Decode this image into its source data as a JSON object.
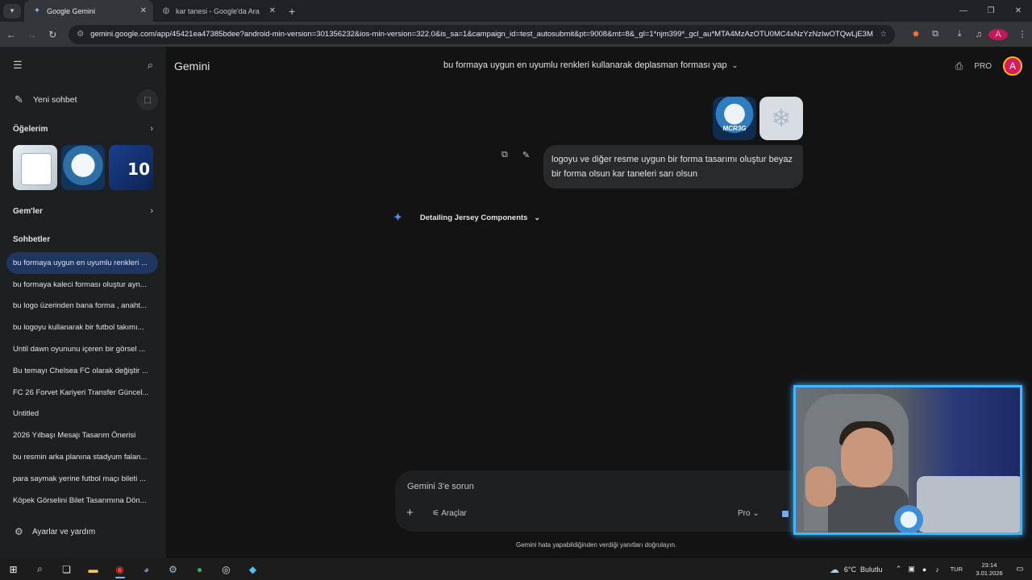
{
  "browser": {
    "tabs": [
      {
        "title": "Google Gemini",
        "active": true
      },
      {
        "title": "kar tanesi - Google'da Ara",
        "active": false
      }
    ],
    "url": "gemini.google.com/app/45421ea47385bdee?android-min-version=301356232&ios-min-version=322.0&is_sa=1&campaign_id=test_autosubmit&pt=9008&mt=8&_gl=1*njm399*_gcl_au*MTA4MzAzOTU0MC4xNzYzNzIwOTQwLjE3MDM5..."
  },
  "sidebar": {
    "new_chat": "Yeni sohbet",
    "items_section": "Öğelerim",
    "gems_section": "Gem'ler",
    "chats_section": "Sohbetler",
    "chats": [
      "bu formaya uygun en uyumlu renkleri ...",
      "bu formaya kaleci forması oluştur ayn...",
      "bu logo üzerinden bana forma , anaht...",
      "bu logoyu kullanarak bir futbol takımı...",
      "Until dawn oyununu içeren bir görsel ...",
      "Bu temayı Chelsea FC olarak değiştir ...",
      "FC 26 Forvet Kariyeri Transfer Güncel...",
      "Untitled",
      "2026 Yılbaşı Mesajı Tasarım Önerisi",
      "bu resmin arka planına stadyum falan...",
      "para saymak yerine futbol maçı bileti ...",
      "Köpek Görselini Bilet Tasarımına Dön..."
    ],
    "settings": "Ayarlar ve yardım"
  },
  "header": {
    "brand": "Gemini",
    "conversation_title": "bu formaya uygun en uyumlu renkleri kullanarak deplasman forması yap",
    "pro_label": "PRO",
    "avatar_letter": "A"
  },
  "conversation": {
    "attachment_1_text": "MCR3G",
    "user_message": "logoyu ve diğer resme uygun bir forma tasarımı oluştur beyaz bir forma olsun kar taneleri sarı olsun",
    "thinking_label": "Detailing Jersey Components"
  },
  "composer": {
    "placeholder": "Gemini 3'e sorun",
    "tools_label": "Araçlar",
    "model_label": "Pro",
    "disclaimer": "Gemini hata yapabildiğinden verdiği yanıtları doğrulayın."
  },
  "taskbar": {
    "temperature": "6°C",
    "weather": "Bulutlu",
    "language": "TUR",
    "time": "23:14",
    "date": "3.01.2026"
  },
  "colors": {
    "background": "#131314",
    "sidebar": "#1e1f20",
    "active_chat": "#1f3760",
    "accent_blue": "#4c8df6",
    "avatar": "#d81b60"
  }
}
